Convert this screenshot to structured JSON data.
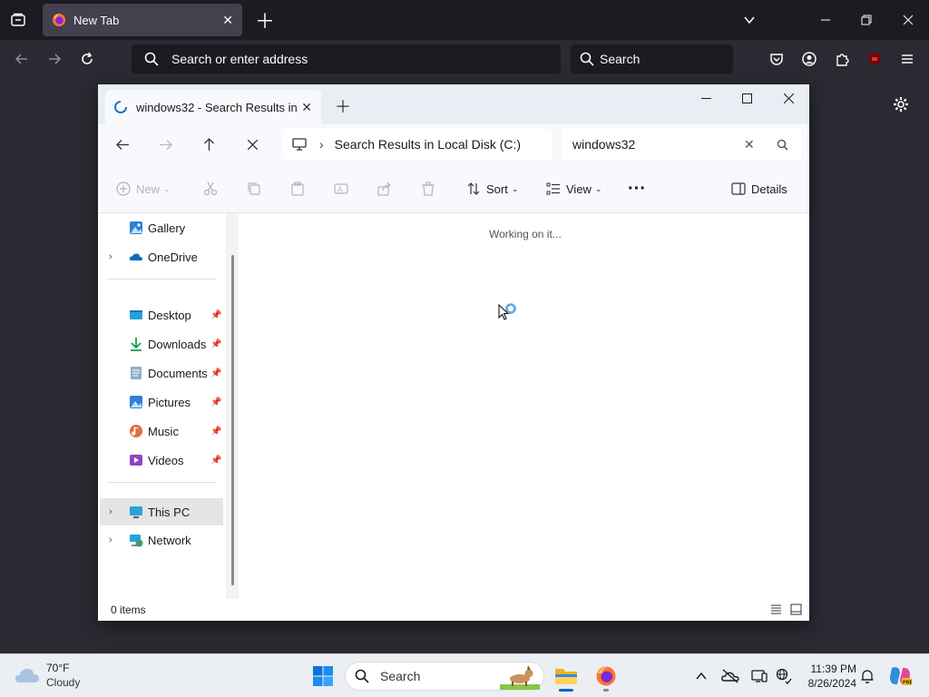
{
  "firefox": {
    "tab_title": "New Tab",
    "url_placeholder": "Search or enter address",
    "search_placeholder": "Search"
  },
  "explorer": {
    "tab_title": "windows32 - Search Results in",
    "address_text": "Search Results in Local Disk (C:)",
    "search_value": "windows32",
    "commands": {
      "new": "New",
      "sort": "Sort",
      "view": "View",
      "details": "Details"
    },
    "sidebar": [
      {
        "label": "Gallery",
        "icon": "gallery-icon",
        "pinned": false,
        "expandable": false
      },
      {
        "label": "OneDrive",
        "icon": "onedrive-icon",
        "pinned": false,
        "expandable": true
      },
      {
        "label": "Desktop",
        "icon": "desktop-folder-icon",
        "pinned": true,
        "expandable": false
      },
      {
        "label": "Downloads",
        "icon": "downloads-folder-icon",
        "pinned": true,
        "expandable": false
      },
      {
        "label": "Documents",
        "icon": "documents-folder-icon",
        "pinned": true,
        "expandable": false
      },
      {
        "label": "Pictures",
        "icon": "pictures-folder-icon",
        "pinned": true,
        "expandable": false
      },
      {
        "label": "Music",
        "icon": "music-folder-icon",
        "pinned": true,
        "expandable": false
      },
      {
        "label": "Videos",
        "icon": "videos-folder-icon",
        "pinned": true,
        "expandable": false
      },
      {
        "label": "This PC",
        "icon": "this-pc-icon",
        "pinned": false,
        "expandable": true,
        "selected": true
      },
      {
        "label": "Network",
        "icon": "network-icon",
        "pinned": false,
        "expandable": true
      }
    ],
    "status_message": "Working on it...",
    "item_count": "0 items"
  },
  "taskbar": {
    "weather_temp": "70°F",
    "weather_desc": "Cloudy",
    "search_placeholder": "Search",
    "time": "11:39 PM",
    "date": "8/26/2024"
  },
  "colors": {
    "firefox_dark": "#1c1b22",
    "firefox_toolbar": "#2b2a33",
    "accent_blue": "#0067c0",
    "selection_gray": "#e5e5e5"
  }
}
